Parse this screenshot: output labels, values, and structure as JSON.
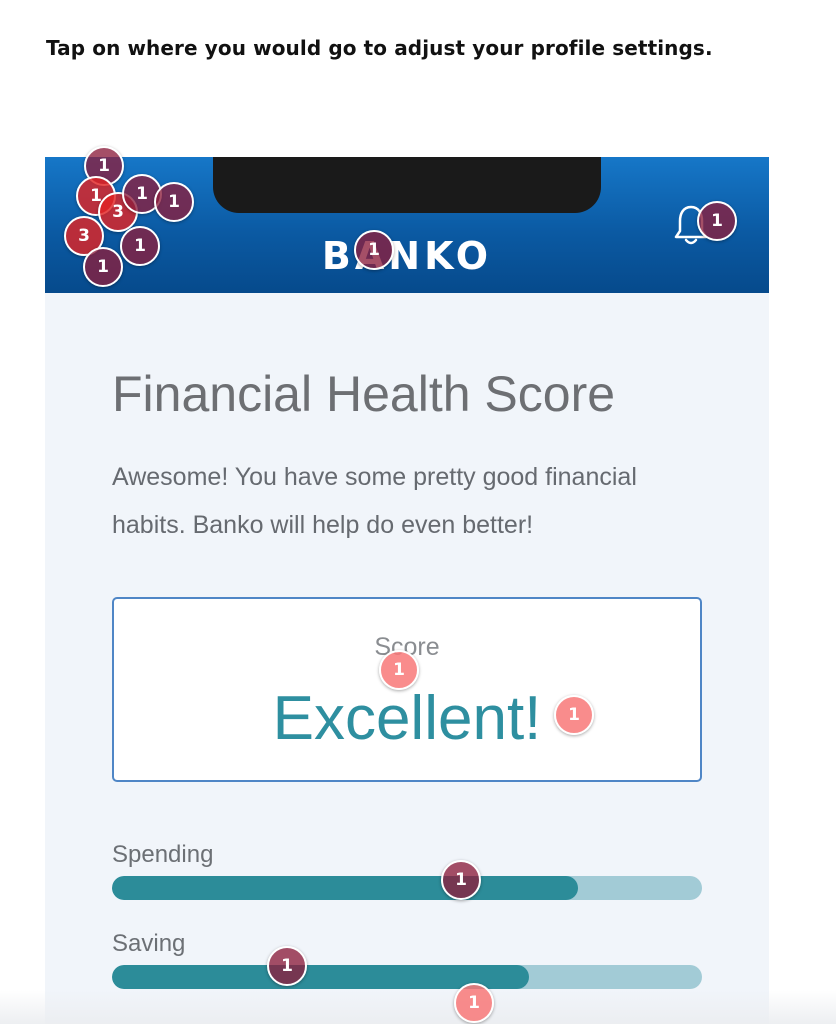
{
  "task": {
    "prompt": "Tap on where you would go to adjust your profile settings."
  },
  "app": {
    "brand": "BANKO",
    "icons": {
      "notification": "bell-icon"
    }
  },
  "content": {
    "title": "Financial Health Score",
    "description": "Awesome! You have some pretty good financial habits. Banko will help do even better!",
    "score_label": "Score",
    "score_value": "Excellent!"
  },
  "metrics": [
    {
      "label": "Spending",
      "fill_fraction": 0.79
    },
    {
      "label": "Saving",
      "fill_fraction": 0.707
    }
  ],
  "heatmap": {
    "markers": [
      {
        "label": "1",
        "tone": "dark"
      },
      {
        "label": "1",
        "tone": "red"
      },
      {
        "label": "3",
        "tone": "red"
      },
      {
        "label": "1",
        "tone": "dark"
      },
      {
        "label": "1",
        "tone": "dark"
      },
      {
        "label": "3",
        "tone": "red"
      },
      {
        "label": "1",
        "tone": "dark"
      },
      {
        "label": "1",
        "tone": "dark"
      },
      {
        "label": "1",
        "tone": "dark"
      },
      {
        "label": "1",
        "tone": "dark"
      },
      {
        "label": "1",
        "tone": "light"
      },
      {
        "label": "1",
        "tone": "light"
      },
      {
        "label": "1",
        "tone": "dark"
      },
      {
        "label": "1",
        "tone": "dark"
      },
      {
        "label": "1",
        "tone": "light"
      }
    ],
    "colors": {
      "dark": "#8c1e3c",
      "red": "#e12323",
      "light": "#f87878"
    }
  }
}
